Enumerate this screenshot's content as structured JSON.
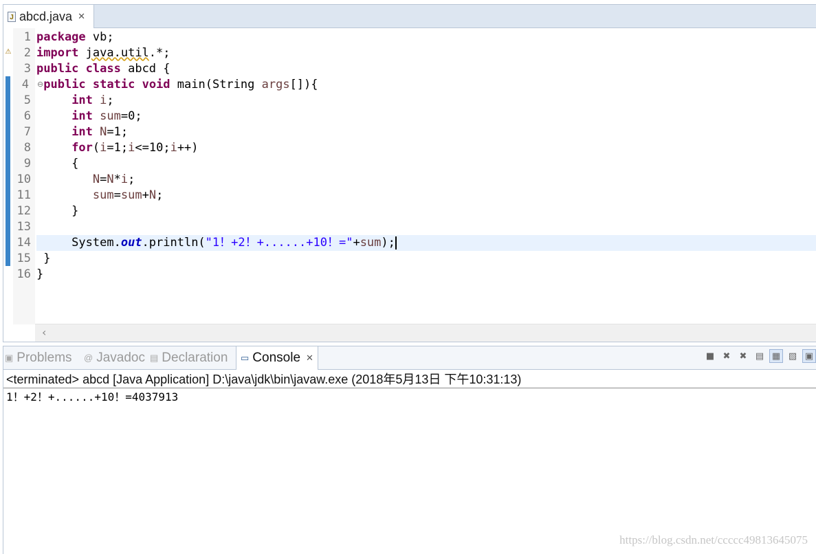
{
  "editor": {
    "tab_title": "abcd.java",
    "line_numbers": [
      "1",
      "2",
      "3",
      "4",
      "5",
      "6",
      "7",
      "8",
      "9",
      "10",
      "11",
      "12",
      "13",
      "14",
      "15",
      "16"
    ]
  },
  "code": {
    "l1": [
      "package",
      " vb;"
    ],
    "l2": [
      "import",
      " ",
      "java.util",
      ".*;"
    ],
    "l3": [
      "public",
      " ",
      "class",
      " abcd {"
    ],
    "l4": [
      " ",
      "public",
      " ",
      "static",
      " ",
      "void",
      " main(String ",
      "args",
      "[]){"
    ],
    "l5": [
      "     ",
      "int",
      " ",
      "i",
      ";"
    ],
    "l6": [
      "     ",
      "int",
      " ",
      "sum",
      "=0;"
    ],
    "l7": [
      "     ",
      "int",
      " ",
      "N",
      "=1;"
    ],
    "l8": [
      "     ",
      "for",
      "(",
      "i",
      "=1;",
      "i",
      "<=10;",
      "i",
      "++)"
    ],
    "l9": "     {",
    "l10": [
      "        ",
      "N",
      "=",
      "N",
      "*",
      "i",
      ";"
    ],
    "l11": [
      "        ",
      "sum",
      "=",
      "sum",
      "+",
      "N",
      ";"
    ],
    "l12": "     }",
    "l14": [
      "     System.",
      "out",
      ".println(",
      "\"1！+2！+......+10！=\"",
      "+",
      "sum",
      ");"
    ],
    "l15": " }",
    "l16": "}"
  },
  "panel": {
    "tabs": [
      "Problems",
      "Javadoc",
      "Declaration",
      "Console"
    ],
    "console_header": "<terminated> abcd [Java Application] D:\\java\\jdk\\bin\\javaw.exe (2018年5月13日 下午10:31:13)",
    "console_output": "1！+2！+......+10！=4037913"
  },
  "watermark": "https://blog.csdn.net/ccccc49813645075"
}
